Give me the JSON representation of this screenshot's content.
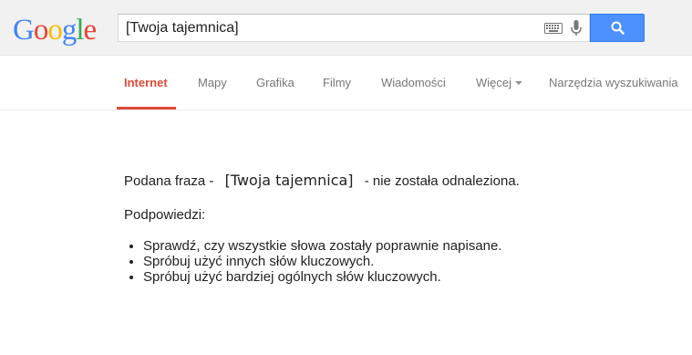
{
  "header": {
    "logo_text": "Google",
    "logo_colors": [
      "#4285f4",
      "#ea4335",
      "#fbbc05",
      "#4285f4",
      "#34a853",
      "#ea4335"
    ],
    "search_value": "[Twoja tajemnica]",
    "keyboard_icon": "keyboard-icon",
    "mic_icon": "microphone-icon",
    "search_icon": "magnifier-icon",
    "search_button_color": "#4d90fe"
  },
  "nav": {
    "tabs": [
      {
        "label": "Internet",
        "active": true
      },
      {
        "label": "Mapy"
      },
      {
        "label": "Grafika"
      },
      {
        "label": "Filmy"
      },
      {
        "label": "Wiadomości"
      },
      {
        "label": "Więcej"
      },
      {
        "label": "Narzędzia wyszukiwania"
      }
    ],
    "active_color": "#dd4b39"
  },
  "results": {
    "prefix": "Podana fraza -",
    "query": "[Twoja tajemnica]",
    "suffix": "- nie została odnaleziona.",
    "hints_title": "Podpowiedzi:",
    "hints": [
      "Sprawdź, czy wszystkie słowa zostały poprawnie napisane.",
      "Spróbuj użyć innych słów kluczowych.",
      "Spróbuj użyć bardziej ogólnych słów kluczowych."
    ]
  }
}
